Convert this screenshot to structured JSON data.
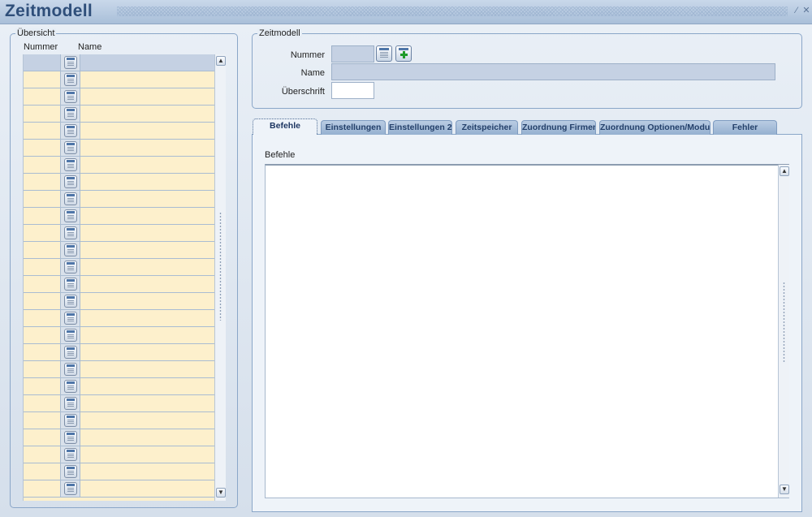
{
  "window": {
    "title": "Zeitmodell",
    "controls": {
      "pin": "⁄",
      "close": "✕"
    }
  },
  "overview": {
    "legend": "Übersicht",
    "columns": {
      "number": "Nummer",
      "name": "Name"
    },
    "rows": [
      {
        "nummer": "",
        "name": "",
        "selected": true
      },
      {
        "nummer": "",
        "name": ""
      },
      {
        "nummer": "",
        "name": ""
      },
      {
        "nummer": "",
        "name": ""
      },
      {
        "nummer": "",
        "name": ""
      },
      {
        "nummer": "",
        "name": ""
      },
      {
        "nummer": "",
        "name": ""
      },
      {
        "nummer": "",
        "name": ""
      },
      {
        "nummer": "",
        "name": ""
      },
      {
        "nummer": "",
        "name": ""
      },
      {
        "nummer": "",
        "name": ""
      },
      {
        "nummer": "",
        "name": ""
      },
      {
        "nummer": "",
        "name": ""
      },
      {
        "nummer": "",
        "name": ""
      },
      {
        "nummer": "",
        "name": ""
      },
      {
        "nummer": "",
        "name": ""
      },
      {
        "nummer": "",
        "name": ""
      },
      {
        "nummer": "",
        "name": ""
      },
      {
        "nummer": "",
        "name": ""
      },
      {
        "nummer": "",
        "name": ""
      },
      {
        "nummer": "",
        "name": ""
      },
      {
        "nummer": "",
        "name": ""
      },
      {
        "nummer": "",
        "name": ""
      },
      {
        "nummer": "",
        "name": ""
      },
      {
        "nummer": "",
        "name": ""
      },
      {
        "nummer": "",
        "name": ""
      }
    ]
  },
  "zeitmodell": {
    "legend": "Zeitmodell",
    "nummer_label": "Nummer",
    "nummer_value": "",
    "name_label": "Name",
    "name_value": "",
    "ueberschrift_label": "Überschrift",
    "ueberschrift_value": ""
  },
  "tabs": [
    {
      "label": "Befehle",
      "active": true
    },
    {
      "label": "Einstellungen"
    },
    {
      "label": "Einstellungen 2"
    },
    {
      "label": "Zeitspeicher"
    },
    {
      "label": "Zuordnung Firmen"
    },
    {
      "label": "Zuordnung Optionen/Module"
    },
    {
      "label": "Fehler"
    }
  ],
  "befehle": {
    "label": "Befehle",
    "text": ""
  },
  "colors": {
    "title": "#2f4f7a",
    "row_bg": "#fdf0cc",
    "selected_row": "#c5d1e3",
    "tab": "#95b0d0",
    "border": "#8aa6c8"
  },
  "icons": {
    "list_button": "document-list-icon",
    "add_button": "add-plus-icon"
  }
}
